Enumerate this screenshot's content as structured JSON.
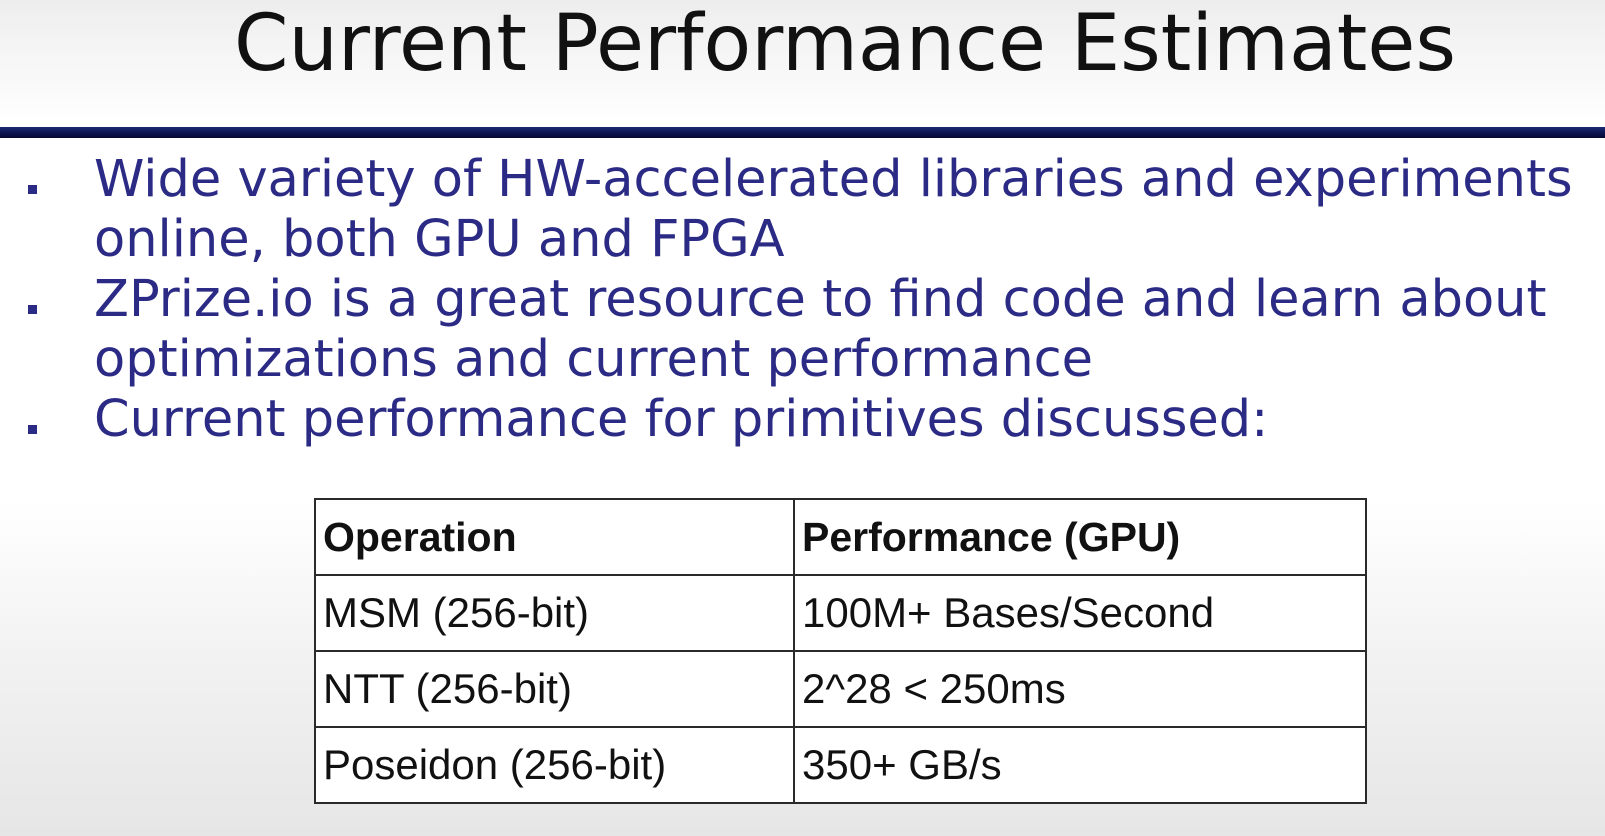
{
  "slide": {
    "title": "Current Performance Estimates",
    "accent_color": "#0b1450",
    "text_color": "#2b2b86"
  },
  "bullets": [
    {
      "lines": [
        "Wide variety of HW-accelerated libraries and experiments",
        "online, both GPU and FPGA"
      ]
    },
    {
      "lines": [
        "ZPrize.io is a great resource to find code and learn about",
        "optimizations and current performance"
      ]
    },
    {
      "lines": [
        "Current performance for primitives discussed:"
      ]
    }
  ],
  "table": {
    "headers": [
      "Operation",
      "Performance (GPU)"
    ],
    "rows": [
      [
        "MSM (256-bit)",
        "100M+ Bases/Second"
      ],
      [
        "NTT (256-bit)",
        "2^28 < 250ms"
      ],
      [
        "Poseidon (256-bit)",
        "350+ GB/s"
      ]
    ]
  }
}
